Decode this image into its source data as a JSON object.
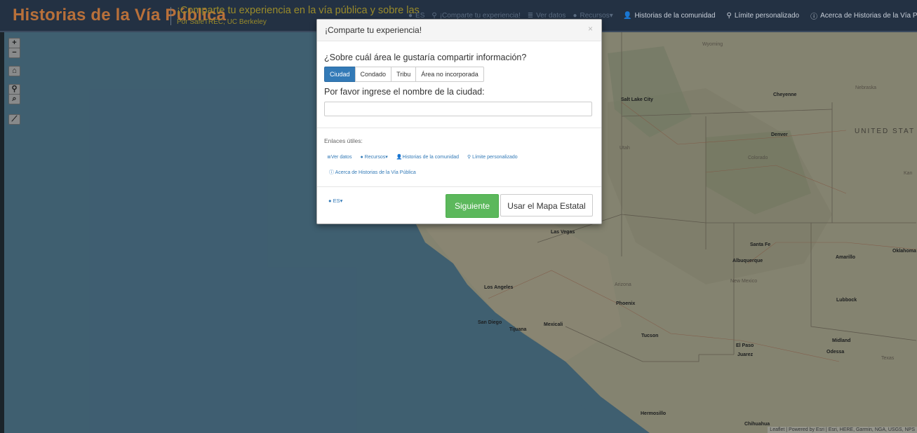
{
  "navbar": {
    "brand": "Historias de la Vía Pública",
    "tagline": "¡Comparte tu experiencia en la vía pública y sobre las",
    "byline": "Por SafeTREC, UC Berkeley",
    "hidden_items": [
      "ES",
      "¡Comparte tu experiencia!",
      "Ver datos",
      "Recursos"
    ],
    "items": [
      {
        "icon": "user-icon",
        "label": "Historias de la comunidad"
      },
      {
        "icon": "map-marker-icon",
        "label": "Límite personalizado"
      },
      {
        "icon": "info-circle-icon",
        "label": "Acerca de Historias de la Vía Pública"
      }
    ]
  },
  "map": {
    "controls": [
      "+",
      "−",
      "⌂",
      "⚲",
      "⌕",
      "⟋"
    ],
    "attribution": "Leaflet | Powered by Esri | Esri, HERE, Garmin, NGA, USGS, NPS",
    "cities": [
      "Salt Lake City",
      "Cheyenne",
      "Denver",
      "Las Vegas",
      "Santa Fe",
      "Albuquerque",
      "Amarillo",
      "Oklahoma",
      "Los Angeles",
      "Phoenix",
      "Lubbock",
      "San Diego",
      "Tijuana",
      "Mexicali",
      "Tucson",
      "El Paso",
      "Juarez",
      "Midland",
      "Odessa",
      "Hermosillo",
      "Chihuahua"
    ],
    "states": [
      "Wyoming",
      "Nebraska",
      "Utah",
      "Colorado",
      "Kan",
      "Arizona",
      "New Mexico",
      "Texas"
    ],
    "country": "UNITED STAT"
  },
  "modal": {
    "title": "¡Comparte tu experiencia!",
    "close": "×",
    "question": "¿Sobre cuál área le gustaría compartir información?",
    "area_options": [
      "Ciudad",
      "Condado",
      "Tribu",
      "Área no incorporada"
    ],
    "selected_area": "Ciudad",
    "city_label": "Por favor ingrese el nombre de la ciudad:",
    "city_value": "",
    "links_title": "Enlaces útiles:",
    "links": [
      "Ver datos",
      "Recursos",
      "Historias de la comunidad",
      "Límite personalizado"
    ],
    "links2": "Acerca de Historias de la Vía Pública",
    "lang": "ES",
    "next_button": "Siguiente",
    "state_map_button": "Usar el Mapa Estatal"
  },
  "colors": {
    "navbar_bg": "#233143",
    "brand": "#b8703a",
    "tagline": "#9a8b2a",
    "primary": "#337ab7",
    "success": "#5cb85c"
  }
}
